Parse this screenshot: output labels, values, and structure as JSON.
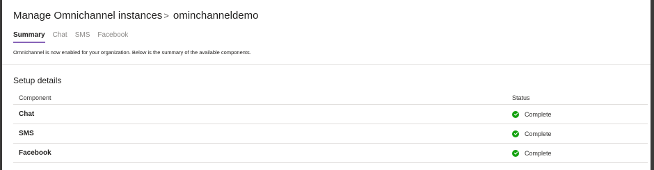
{
  "breadcrumb": {
    "parent": "Manage Omnichannel instances",
    "separator": ">",
    "current": "ominchanneldemo"
  },
  "tabs": [
    {
      "label": "Summary",
      "active": true
    },
    {
      "label": "Chat",
      "active": false
    },
    {
      "label": "SMS",
      "active": false
    },
    {
      "label": "Facebook",
      "active": false
    }
  ],
  "notice": "Omnichannel is now enabled for your organization. Below is the summary of the available components.",
  "setup": {
    "title": "Setup details",
    "columns": {
      "component": "Component",
      "status": "Status"
    },
    "rows": [
      {
        "component": "Chat",
        "status": "Complete",
        "status_icon": "check-circle-icon"
      },
      {
        "component": "SMS",
        "status": "Complete",
        "status_icon": "check-circle-icon"
      },
      {
        "component": "Facebook",
        "status": "Complete",
        "status_icon": "check-circle-icon"
      }
    ]
  },
  "colors": {
    "tab_accent": "#8764b8",
    "success": "#13a10e",
    "divider": "#e1dfdd"
  }
}
